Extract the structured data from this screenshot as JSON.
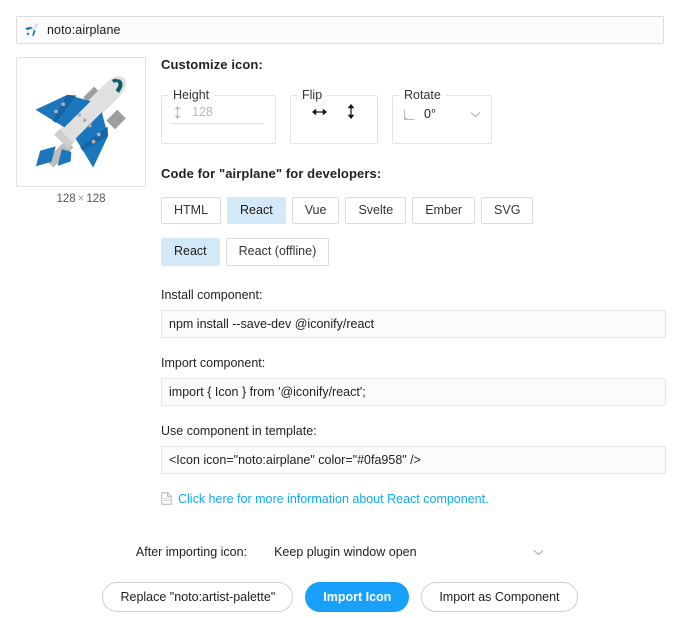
{
  "search": {
    "value": "noto:airplane",
    "icon": "airplane-icon"
  },
  "preview": {
    "icon": "airplane-icon",
    "width": "128",
    "separator": "×",
    "height": "128"
  },
  "customize": {
    "title": "Customize icon:",
    "height": {
      "legend": "Height",
      "placeholder": "128",
      "value": "128",
      "icon": "height-arrows-icon"
    },
    "flip": {
      "legend": "Flip",
      "horizontal_icon": "flip-horizontal-icon",
      "vertical_icon": "flip-vertical-icon"
    },
    "rotate": {
      "legend": "Rotate",
      "icon": "rotate-angle-icon",
      "value": "0°",
      "chevron": "chevron-down-icon"
    }
  },
  "code": {
    "title": "Code for \"airplane\" for developers:",
    "framework_tabs": [
      {
        "label": "HTML",
        "active": false
      },
      {
        "label": "React",
        "active": true
      },
      {
        "label": "Vue",
        "active": false
      },
      {
        "label": "Svelte",
        "active": false
      },
      {
        "label": "Ember",
        "active": false
      },
      {
        "label": "SVG",
        "active": false
      }
    ],
    "variant_tabs": [
      {
        "label": "React",
        "active": true
      },
      {
        "label": "React (offline)",
        "active": false
      }
    ],
    "install_label": "Install component:",
    "install_code": "npm install --save-dev @iconify/react",
    "import_label": "Import component:",
    "import_code": "import { Icon } from '@iconify/react';",
    "template_label": "Use component in template:",
    "template_code": "<Icon icon=\"noto:airplane\" color=\"#0fa958\" />",
    "more_info_icon": "document-icon",
    "more_info_link": "Click here for more information about React component."
  },
  "footer": {
    "after_import_label": "After importing icon:",
    "after_import_value": "Keep plugin window open",
    "chevron": "chevron-down-icon",
    "replace_button": "Replace \"noto:artist-palette\"",
    "import_button": "Import Icon",
    "import_component_button": "Import as Component"
  },
  "colors": {
    "accent": "#18a0fb",
    "link": "#0eaaf5",
    "tab_active_bg": "#d4e9f7",
    "icon_blue": "#1b76bc",
    "icon_gray": "#b3b3b3",
    "icon_light": "#e0e0e0"
  }
}
